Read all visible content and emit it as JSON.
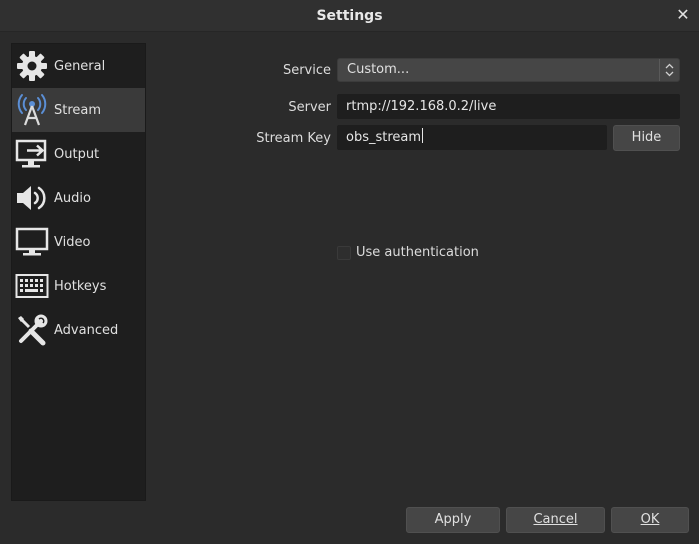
{
  "window": {
    "title": "Settings",
    "close_icon": "close-icon"
  },
  "sidebar": {
    "items": [
      {
        "label": "General",
        "icon": "gear-icon"
      },
      {
        "label": "Stream",
        "icon": "broadcast-tower-icon",
        "active": true
      },
      {
        "label": "Output",
        "icon": "output-monitor-icon"
      },
      {
        "label": "Audio",
        "icon": "speaker-icon"
      },
      {
        "label": "Video",
        "icon": "monitor-icon"
      },
      {
        "label": "Hotkeys",
        "icon": "keyboard-icon"
      },
      {
        "label": "Advanced",
        "icon": "tools-icon"
      }
    ]
  },
  "stream": {
    "service_label": "Service",
    "service_value": "Custom...",
    "server_label": "Server",
    "server_value": "rtmp://192.168.0.2/live",
    "stream_key_label": "Stream Key",
    "stream_key_value": "obs_stream",
    "hide_button": "Hide",
    "use_auth_label": "Use authentication",
    "use_auth_checked": false
  },
  "footer": {
    "apply": "Apply",
    "cancel": "Cancel",
    "ok": "OK"
  },
  "colors": {
    "background": "#2b2b2b",
    "sidebar": "#1e1e1e",
    "sidebar_active": "#3a3a3a",
    "button": "#464646",
    "input": "#1e1e1e",
    "icon_blue": "#5b8fd6"
  }
}
